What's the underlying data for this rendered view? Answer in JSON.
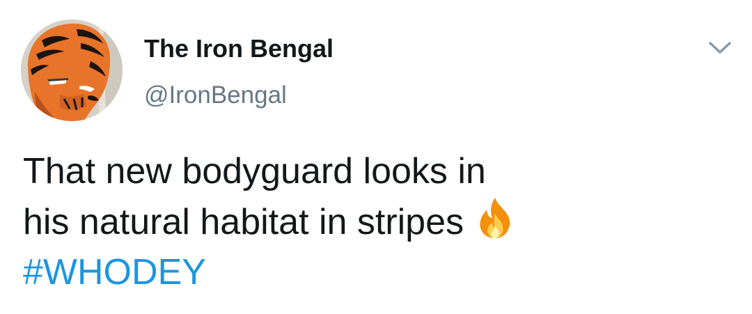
{
  "user": {
    "display_name": "The Iron Bengal",
    "handle": "@IronBengal",
    "avatar": "iron-bengal-helmet-avatar"
  },
  "tweet": {
    "line1": "That new bodyguard looks in",
    "line2": "his natural habitat in stripes",
    "emoji": "fire-icon",
    "hashtag": "#WHODEY"
  },
  "menu": {
    "icon": "chevron-down-icon"
  },
  "colors": {
    "text": "#14171a",
    "secondary": "#657786",
    "link": "#1b95e0",
    "chevron": "#8899a6"
  }
}
